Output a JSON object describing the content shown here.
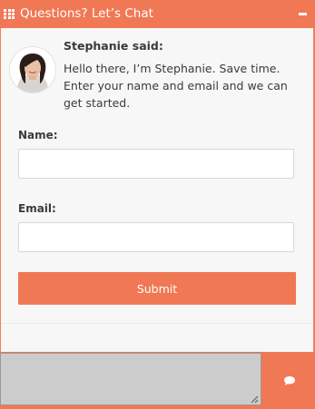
{
  "header": {
    "title": "Questions? Let’s Chat",
    "menu_icon": "grid-icon",
    "minimize_icon": "minus-icon"
  },
  "agent": {
    "said_label": "Stephanie said:",
    "message": "Hello there, I’m Stephanie.  Save time. Enter your name and email and we can get started."
  },
  "form": {
    "name_label": "Name:",
    "name_value": "",
    "email_label": "Email:",
    "email_value": "",
    "submit_label": "Submit"
  },
  "composer": {
    "message_value": "",
    "send_icon": "chat-bubble-icon"
  },
  "colors": {
    "accent": "#f07855",
    "panel": "#f7f7f7",
    "text": "#3a3a3a",
    "composer_field": "#cccccc"
  }
}
